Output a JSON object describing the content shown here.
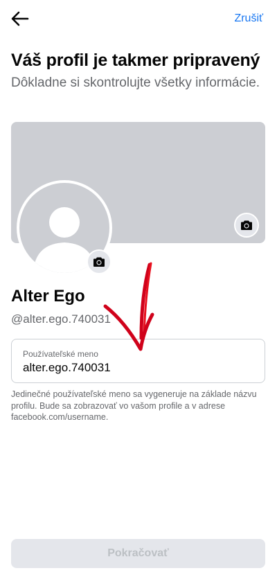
{
  "header": {
    "back_icon": "arrow-left-icon",
    "cancel_label": "Zrušiť"
  },
  "intro": {
    "title": "Váš profil je takmer pripravený",
    "subtitle": "Dôkladne si skontrolujte všetky informácie."
  },
  "profile": {
    "name": "Alter Ego",
    "handle": "@alter.ego.740031",
    "cover_camera_icon": "camera-icon",
    "avatar_camera_icon": "camera-icon",
    "avatar_icon": "default-user-silhouette-icon"
  },
  "username_field": {
    "label": "Používateľské meno",
    "value": "alter.ego.740031"
  },
  "helper_text": "Jedinečné používateľské meno sa vygeneruje na základe názvu profilu. Bude sa zobrazovať vo vašom profile a v adrese facebook.com/username.",
  "footer": {
    "continue_label": "Pokračovať"
  },
  "colors": {
    "accent": "#1877f2",
    "annotation_arrow": "#d0021b",
    "placeholder_gray": "#ccced3"
  }
}
